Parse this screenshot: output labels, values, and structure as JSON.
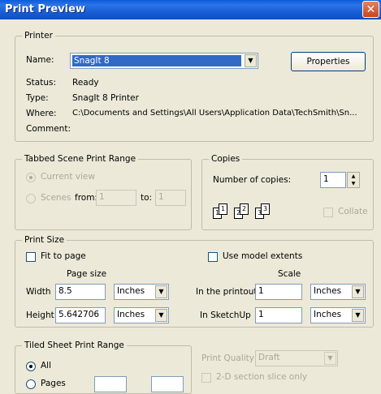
{
  "window": {
    "title": "Print Preview",
    "close_glyph": "✕"
  },
  "printer": {
    "legend": "Printer",
    "name_label": "Name:",
    "name_value": "SnagIt 8",
    "properties_label": "Properties",
    "status_label": "Status:",
    "status_value": "Ready",
    "type_label": "Type:",
    "type_value": "SnagIt 8 Printer",
    "where_label": "Where:",
    "where_value": "C:\\Documents and Settings\\All Users\\Application Data\\TechSmith\\Sn...",
    "comment_label": "Comment:"
  },
  "scene_range": {
    "legend": "Tabbed Scene Print Range",
    "current_view_label": "Current view",
    "scenes_label": "Scenes",
    "from_label": "from:",
    "from_value": "1",
    "to_label": "to:",
    "to_value": "1"
  },
  "copies": {
    "legend": "Copies",
    "number_label": "Number of copies:",
    "number_value": "1",
    "collate_label": "Collate",
    "page_numbers": [
      "1",
      "1",
      "2",
      "2",
      "3",
      "3"
    ]
  },
  "print_size": {
    "legend": "Print Size",
    "fit_to_page_label": "Fit to page",
    "use_model_extents_label": "Use model extents",
    "page_size_label": "Page size",
    "scale_label": "Scale",
    "width_label": "Width",
    "width_value": "8.5",
    "width_unit": "Inches",
    "height_label": "Height",
    "height_value": "5.642706",
    "height_unit": "Inches",
    "in_printout_label": "In the printout",
    "in_printout_value": "1",
    "in_printout_unit": "Inches",
    "in_sketchup_label": "In SketchUp",
    "in_sketchup_value": "1",
    "in_sketchup_unit": "Inches"
  },
  "tiled": {
    "legend": "Tiled Sheet Print Range",
    "all_label": "All",
    "pages_label": "Pages",
    "print_quality_label": "Print Quality",
    "print_quality_value": "Draft",
    "section_slice_label": "2-D section slice only"
  }
}
